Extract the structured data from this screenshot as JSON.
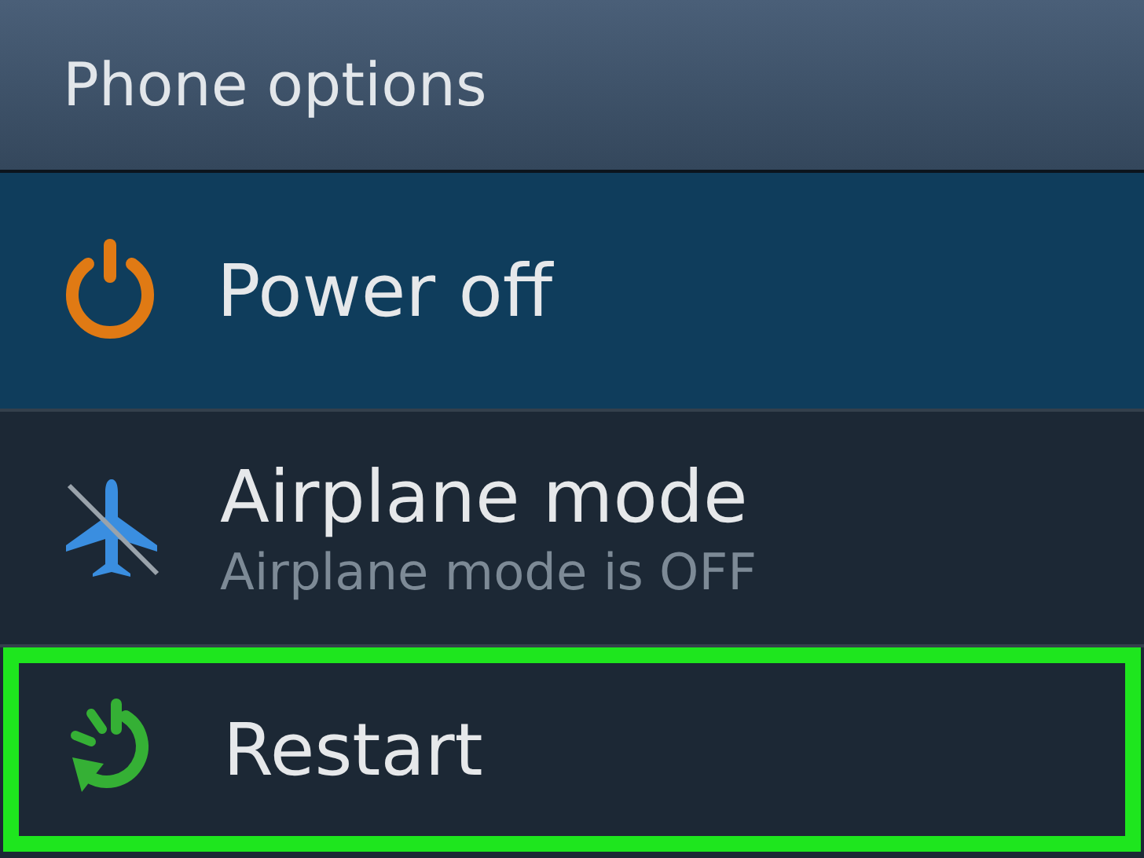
{
  "header": {
    "title": "Phone options"
  },
  "items": [
    {
      "kind": "power",
      "title": "Power off",
      "selected": true,
      "highlighted": false
    },
    {
      "kind": "airplane",
      "title": "Airplane mode",
      "subtitle": "Airplane mode is OFF",
      "selected": false,
      "highlighted": false
    },
    {
      "kind": "restart",
      "title": "Restart",
      "selected": false,
      "highlighted": true
    }
  ]
}
